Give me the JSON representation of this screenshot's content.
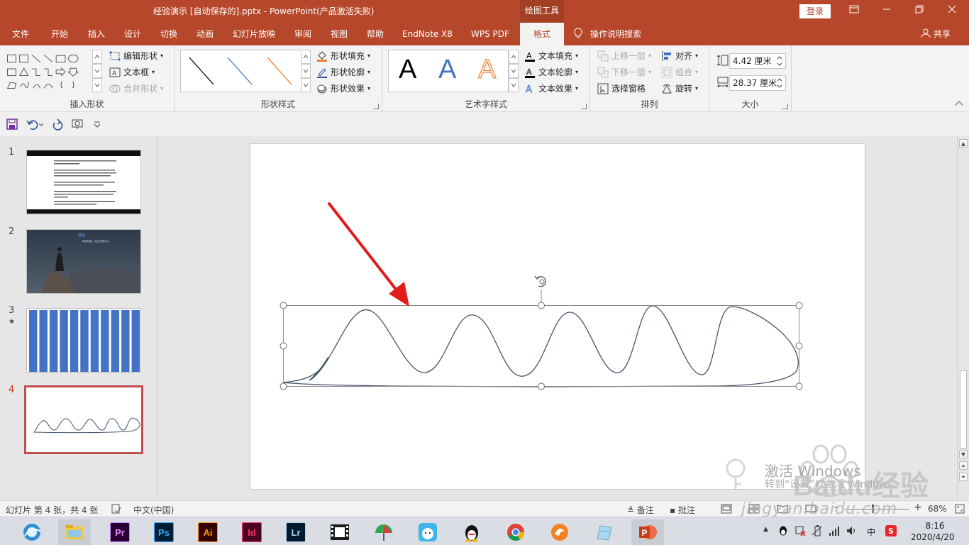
{
  "window": {
    "title": "经验演示 [自动保存的].pptx  -  PowerPoint(产品激活失败)",
    "tools_tab": "绘图工具",
    "login": "登录",
    "min_icon": "minimize-icon",
    "restore_icon": "restore-icon",
    "close_icon": "close-icon"
  },
  "tabs": [
    "文件",
    "开始",
    "插入",
    "设计",
    "切换",
    "动画",
    "幻灯片放映",
    "审阅",
    "视图",
    "帮助",
    "EndNote X8",
    "WPS PDF",
    "格式"
  ],
  "active_tab": "格式",
  "tell_me": "操作说明搜索",
  "share": "共享",
  "ribbon": {
    "insert_shapes": {
      "label": "插入形状",
      "edit_shape": "编辑形状",
      "text_box": "文本框",
      "merge_shapes": "合并形状"
    },
    "shape_styles": {
      "label": "形状样式",
      "fill": "形状填充",
      "outline": "形状轮廓",
      "effects": "形状效果"
    },
    "wordart_styles": {
      "label": "艺术字样式",
      "letter": "A",
      "text_fill": "文本填充",
      "text_outline": "文本轮廓",
      "text_effects": "文本效果"
    },
    "arrange": {
      "label": "排列",
      "bring_forward": "上移一层",
      "send_backward": "下移一层",
      "selection_pane": "选择窗格",
      "align": "对齐",
      "group": "组合",
      "rotate": "旋转"
    },
    "size": {
      "label": "大小",
      "height": "4.42 厘米",
      "width": "28.37 厘米"
    }
  },
  "thumbnails": [
    {
      "num": "1",
      "marker": ""
    },
    {
      "num": "2",
      "marker": "",
      "title": "姓名",
      "subtitle": "年级年级，班主任姓名人"
    },
    {
      "num": "3",
      "marker": "★"
    },
    {
      "num": "4",
      "marker": ""
    }
  ],
  "watermark": {
    "activate": "激活 Windows",
    "activate_sub": "转到“设置”以激活 Windows。",
    "baidu": "Baidu经验",
    "url": "jingyan.baidu.com"
  },
  "status": {
    "slide_info": "幻灯片 第 4 张，共 4 张",
    "language": "中文(中国)",
    "notes": "备注",
    "comments": "批注",
    "zoom": "68%",
    "minus": "-",
    "plus": "+"
  },
  "taskbar": {
    "apps": [
      {
        "name": "browser",
        "label": ""
      },
      {
        "name": "file-explorer",
        "label": ""
      },
      {
        "name": "premiere",
        "label": "Pr"
      },
      {
        "name": "photoshop",
        "label": "Ps"
      },
      {
        "name": "illustrator",
        "label": "Ai"
      },
      {
        "name": "indesign",
        "label": "Id"
      },
      {
        "name": "lightroom",
        "label": "Lr"
      },
      {
        "name": "video-editor",
        "label": ""
      },
      {
        "name": "umbrella-app",
        "label": ""
      },
      {
        "name": "cat-app",
        "label": ""
      },
      {
        "name": "qq",
        "label": ""
      },
      {
        "name": "chrome",
        "label": ""
      },
      {
        "name": "orange-app",
        "label": ""
      },
      {
        "name": "notes-app",
        "label": ""
      },
      {
        "name": "powerpoint",
        "label": "P"
      }
    ],
    "ime": "中",
    "time": "8:16",
    "date": "2020/4/20"
  },
  "colors": {
    "accent": "#b7472a",
    "curve": "#44546a",
    "arrow": "#e21b1b",
    "thumb3": "#4472c4"
  }
}
